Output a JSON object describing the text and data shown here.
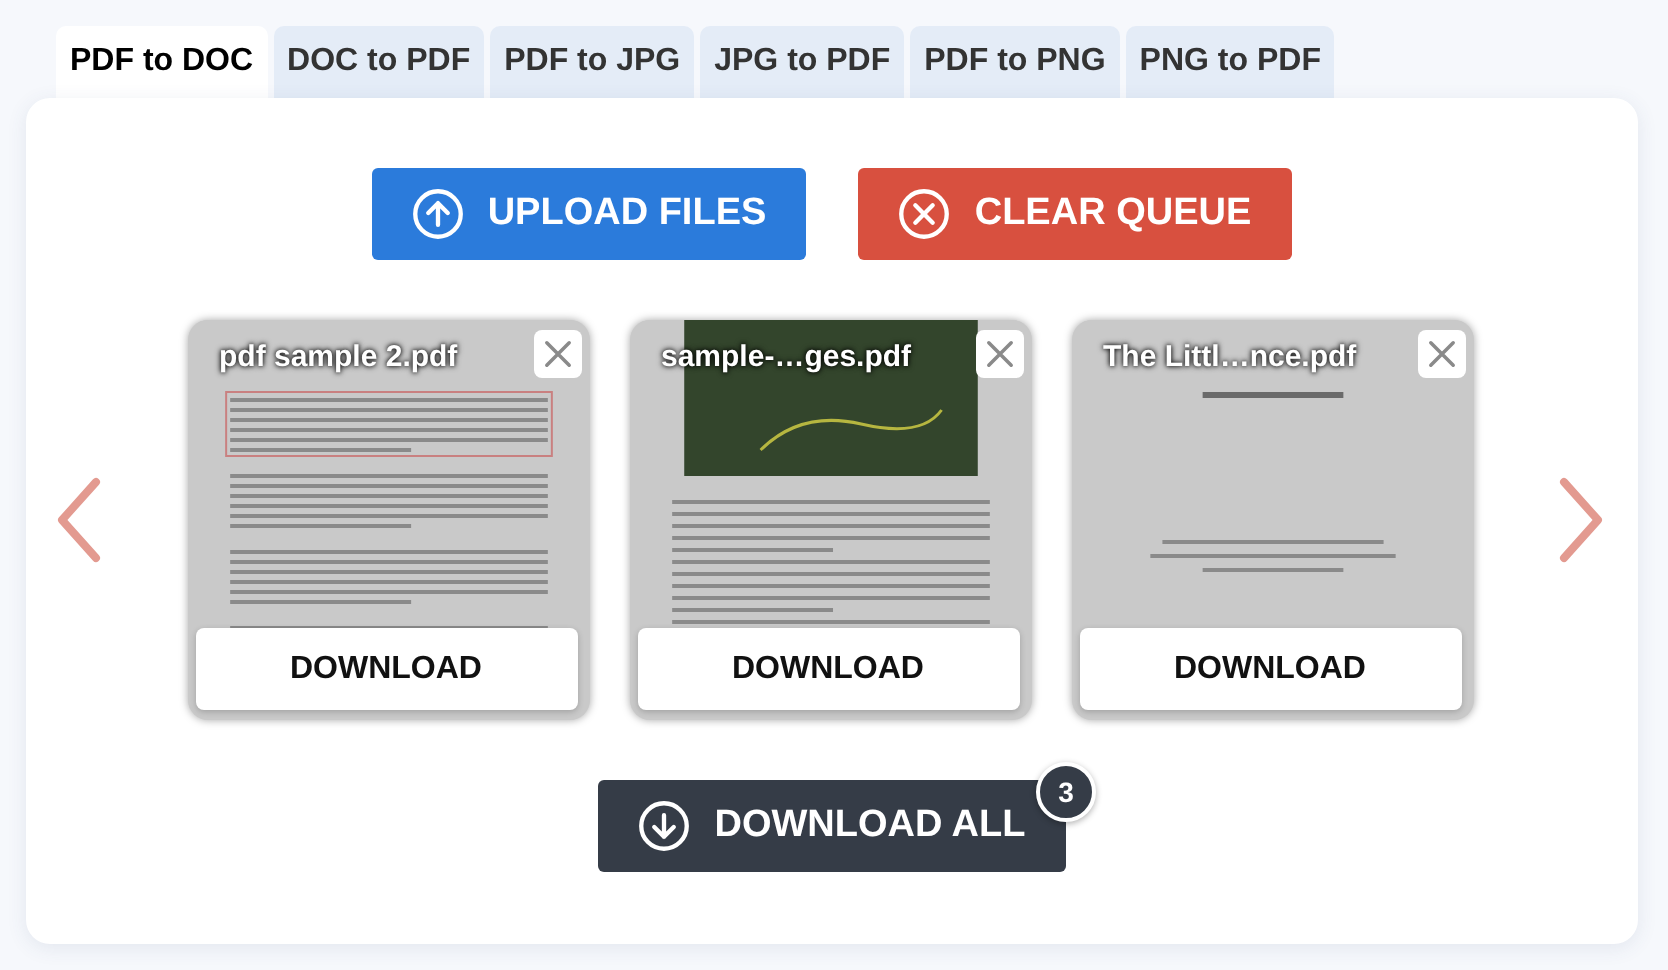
{
  "tabs": [
    {
      "label": "PDF to DOC",
      "selected": true
    },
    {
      "label": "DOC to PDF",
      "selected": false
    },
    {
      "label": "PDF to JPG",
      "selected": false
    },
    {
      "label": "JPG to PDF",
      "selected": false
    },
    {
      "label": "PDF to PNG",
      "selected": false
    },
    {
      "label": "PNG to PDF",
      "selected": false
    }
  ],
  "actions": {
    "upload": "UPLOAD FILES",
    "clear": "CLEAR QUEUE"
  },
  "files": [
    {
      "name": "pdf sample 2.pdf",
      "kind": "text",
      "download": "DOWNLOAD"
    },
    {
      "name": "sample-…ges.pdf",
      "kind": "map",
      "download": "DOWNLOAD"
    },
    {
      "name": "The Littl…nce.pdf",
      "kind": "title",
      "download": "DOWNLOAD"
    }
  ],
  "download_all": {
    "label": "DOWNLOAD ALL",
    "count": "3"
  }
}
